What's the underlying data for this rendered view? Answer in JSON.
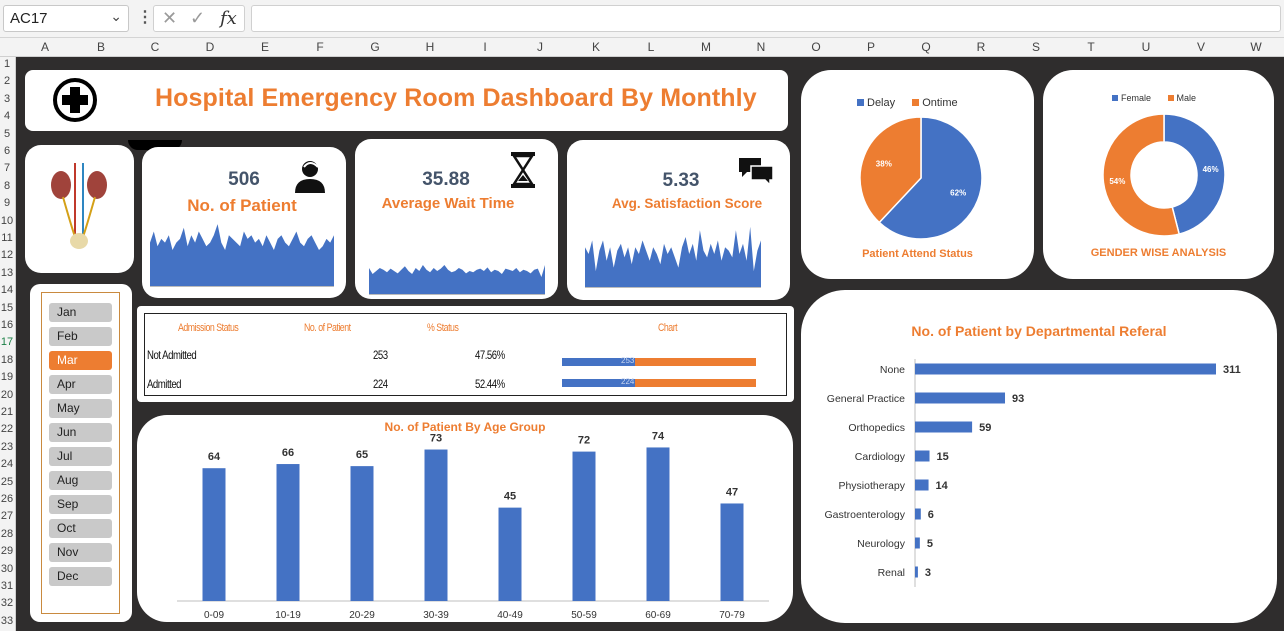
{
  "formula_bar": {
    "name_box": "AC17",
    "fx": "fx",
    "cancel": "✕",
    "enter": "✓"
  },
  "columns": [
    "A",
    "B",
    "C",
    "D",
    "E",
    "F",
    "G",
    "H",
    "I",
    "J",
    "K",
    "L",
    "M",
    "N",
    "O",
    "P",
    "Q",
    "R",
    "S",
    "T",
    "U",
    "V",
    "W"
  ],
  "rows": [
    "1",
    "2",
    "3",
    "4",
    "5",
    "6",
    "7",
    "8",
    "9",
    "10",
    "11",
    "12",
    "13",
    "14",
    "15",
    "16",
    "17",
    "18",
    "19",
    "20",
    "21",
    "22",
    "23",
    "24",
    "25",
    "26",
    "27",
    "28",
    "29",
    "30",
    "31",
    "32",
    "33"
  ],
  "dashboard": {
    "title": "Hospital Emergency Room Dashboard By Monthly",
    "kpis": [
      {
        "value": "506",
        "label": "No. of Patient",
        "icon": "patient-icon"
      },
      {
        "value": "35.88",
        "label": "Average Wait Time",
        "icon": "hourglass-icon"
      },
      {
        "value": "5.33",
        "label": "Avg. Satisfaction Score",
        "icon": "chat-bubbles-icon"
      }
    ],
    "months": [
      "Jan",
      "Feb",
      "Mar",
      "Apr",
      "May",
      "Jun",
      "Jul",
      "Aug",
      "Sep",
      "Oct",
      "Nov",
      "Dec"
    ],
    "selected_month": "Mar",
    "admission": {
      "headers": [
        "Admission Status",
        "No. of Patient",
        "% Status",
        "Chart"
      ],
      "rows": [
        {
          "status": "Not Admitted",
          "count": "253",
          "pct": "47.56%",
          "bar_label": "253",
          "fraction": 0.3757
        },
        {
          "status": "Admitted",
          "count": "224",
          "pct": "52.44%",
          "bar_label": "224",
          "fraction": 0.3757
        }
      ]
    },
    "colors": {
      "blue": "#4472c4",
      "orange": "#ed7d31",
      "background": "#2f2d2d",
      "title_orange": "#ed7d31"
    }
  },
  "charts": {
    "attend": {
      "title": "Patient Attend Status",
      "legend": [
        "Delay",
        "Ontime"
      ],
      "labels": [
        "62%",
        "38%"
      ]
    },
    "gender": {
      "title": "GENDER WISE ANALYSIS",
      "legend": [
        "Female",
        "Male"
      ],
      "labels": [
        "46%",
        "54%"
      ]
    },
    "age": {
      "title": "No. of Patient By Age Group"
    },
    "dept": {
      "title": "No. of Patient by Departmental Referal"
    }
  },
  "chart_data": [
    {
      "type": "pie",
      "title": "Patient Attend Status",
      "categories": [
        "Delay",
        "Ontime"
      ],
      "values": [
        62,
        38
      ],
      "legend": "top"
    },
    {
      "type": "pie",
      "title": "GENDER WISE ANALYSIS",
      "categories": [
        "Female",
        "Male"
      ],
      "values": [
        46,
        54
      ],
      "legend": "top"
    },
    {
      "type": "bar",
      "title": "No. of Patient By Age Group",
      "categories": [
        "0-09",
        "10-19",
        "20-29",
        "30-39",
        "40-49",
        "50-59",
        "60-69",
        "70-79"
      ],
      "values": [
        64,
        66,
        65,
        73,
        45,
        72,
        74,
        47
      ],
      "ylim": [
        0,
        80
      ]
    },
    {
      "type": "bar",
      "title": "No. of Patient by Departmental Referal",
      "categories": [
        "None",
        "General Practice",
        "Orthopedics",
        "Cardiology",
        "Physiotherapy",
        "Gastroenterology",
        "Neurology",
        "Renal"
      ],
      "values": [
        311,
        93,
        59,
        15,
        14,
        6,
        5,
        3
      ]
    },
    {
      "type": "area",
      "title": "",
      "values": [
        0.6,
        0.75,
        0.55,
        0.65,
        0.6,
        0.7,
        0.5,
        0.6,
        0.65,
        0.8,
        0.55,
        0.7,
        0.6,
        0.75,
        0.65,
        0.55,
        0.6,
        0.7,
        0.85,
        0.6,
        0.5,
        0.7,
        0.65,
        0.6,
        0.55,
        0.75,
        0.65,
        0.7,
        0.6,
        0.65,
        0.55,
        0.7,
        0.6,
        0.5,
        0.65,
        0.7,
        0.6,
        0.55,
        0.65,
        0.75,
        0.6,
        0.55,
        0.65,
        0.7,
        0.6,
        0.5,
        0.55,
        0.65,
        0.6,
        0.7
      ]
    },
    {
      "type": "area",
      "title": "",
      "values": [
        0.45,
        0.35,
        0.4,
        0.45,
        0.42,
        0.38,
        0.44,
        0.4,
        0.36,
        0.42,
        0.48,
        0.4,
        0.35,
        0.45,
        0.4,
        0.5,
        0.42,
        0.38,
        0.45,
        0.4,
        0.44,
        0.5,
        0.42,
        0.38,
        0.4,
        0.45,
        0.42,
        0.36,
        0.4,
        0.38,
        0.42,
        0.44,
        0.4,
        0.46,
        0.38,
        0.42,
        0.4,
        0.35,
        0.44,
        0.42,
        0.4,
        0.45,
        0.38,
        0.42,
        0.4,
        0.36,
        0.42,
        0.44,
        0.3,
        0.5
      ]
    },
    {
      "type": "area",
      "title": "",
      "values": [
        0.6,
        0.5,
        0.7,
        0.25,
        0.55,
        0.7,
        0.4,
        0.6,
        0.3,
        0.55,
        0.65,
        0.45,
        0.6,
        0.35,
        0.6,
        0.5,
        0.7,
        0.55,
        0.4,
        0.6,
        0.5,
        0.35,
        0.65,
        0.5,
        0.6,
        0.45,
        0.3,
        0.6,
        0.75,
        0.5,
        0.65,
        0.4,
        0.85,
        0.55,
        0.45,
        0.65,
        0.5,
        0.7,
        0.4,
        0.6,
        0.55,
        0.45,
        0.85,
        0.5,
        0.65,
        0.4,
        0.9,
        0.25,
        0.55,
        0.7
      ]
    }
  ]
}
